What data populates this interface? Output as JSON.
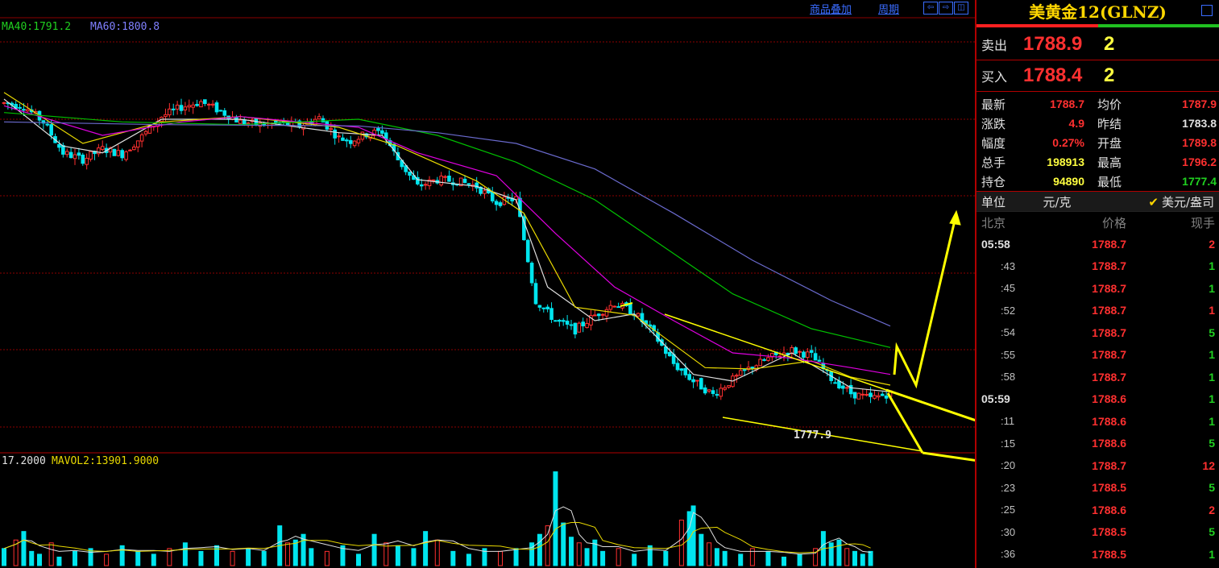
{
  "toolbar": {
    "overlay_label": "商品叠加",
    "period_label": "周期"
  },
  "legend": {
    "ma_line": "MA40:1791.2  MA60:1800.8",
    "ma40": "MA40:1791.2",
    "ma60": "MA60:1800.8",
    "vol_line_a": "17.2000",
    "vol_line_b": "MAVOL2:13901.9000",
    "low_label": "1777.9"
  },
  "colors": {
    "up": "#ff3030",
    "down": "#00e5ee",
    "ma_white": "#e0e0e0",
    "ma_yellow": "#e8d800",
    "ma_magenta": "#e000e0",
    "ma_green": "#00c000",
    "ma_blue": "#6a6acd",
    "annotation": "#ffff00",
    "grid": "#8b0000"
  },
  "chart_data": {
    "type": "candlestick",
    "price_range": [
      1776.0,
      1806.0
    ],
    "price_points": [
      [
        0,
        1801.2
      ],
      [
        5,
        1801.0
      ],
      [
        10,
        1799.8
      ],
      [
        15,
        1797.5
      ],
      [
        20,
        1797.0
      ],
      [
        25,
        1797.8
      ],
      [
        30,
        1797.4
      ],
      [
        35,
        1798.7
      ],
      [
        40,
        1800.2
      ],
      [
        45,
        1800.9
      ],
      [
        50,
        1801.3
      ],
      [
        55,
        1800.6
      ],
      [
        60,
        1799.8
      ],
      [
        65,
        1799.6
      ],
      [
        70,
        1799.7
      ],
      [
        75,
        1799.5
      ],
      [
        80,
        1800.1
      ],
      [
        85,
        1798.6
      ],
      [
        88,
        1798.4
      ],
      [
        92,
        1798.9
      ],
      [
        96,
        1799.1
      ],
      [
        100,
        1797.0
      ],
      [
        105,
        1795.0
      ],
      [
        110,
        1795.5
      ],
      [
        115,
        1795.4
      ],
      [
        120,
        1795.0
      ],
      [
        125,
        1793.8
      ],
      [
        130,
        1794.1
      ],
      [
        135,
        1786.5
      ],
      [
        140,
        1785.0
      ],
      [
        145,
        1784.3
      ],
      [
        150,
        1785.4
      ],
      [
        155,
        1786.3
      ],
      [
        160,
        1785.6
      ],
      [
        165,
        1784.0
      ],
      [
        170,
        1781.8
      ],
      [
        175,
        1780.5
      ],
      [
        180,
        1779.5
      ],
      [
        185,
        1780.6
      ],
      [
        190,
        1781.6
      ],
      [
        195,
        1782.3
      ],
      [
        200,
        1782.8
      ],
      [
        205,
        1782.4
      ],
      [
        210,
        1780.7
      ],
      [
        215,
        1779.6
      ],
      [
        220,
        1779.2
      ],
      [
        225,
        1779.6
      ]
    ],
    "ma_lines": [
      {
        "name": "MA5",
        "color": "#e0e0e0",
        "points": [
          [
            0,
            1801.5
          ],
          [
            15,
            1798.0
          ],
          [
            25,
            1797.5
          ],
          [
            40,
            1800.0
          ],
          [
            60,
            1800.0
          ],
          [
            85,
            1799.0
          ],
          [
            96,
            1798.8
          ],
          [
            105,
            1795.5
          ],
          [
            120,
            1795.0
          ],
          [
            130,
            1794.0
          ],
          [
            138,
            1787.5
          ],
          [
            150,
            1785.0
          ],
          [
            160,
            1785.5
          ],
          [
            175,
            1781.0
          ],
          [
            185,
            1780.5
          ],
          [
            200,
            1782.6
          ],
          [
            215,
            1780.0
          ],
          [
            225,
            1779.7
          ]
        ]
      },
      {
        "name": "MA10",
        "color": "#e8d800",
        "points": [
          [
            0,
            1802.0
          ],
          [
            20,
            1798.2
          ],
          [
            40,
            1799.8
          ],
          [
            60,
            1800.2
          ],
          [
            85,
            1799.4
          ],
          [
            100,
            1798.0
          ],
          [
            120,
            1795.4
          ],
          [
            132,
            1793.0
          ],
          [
            145,
            1786.0
          ],
          [
            160,
            1785.4
          ],
          [
            178,
            1781.5
          ],
          [
            190,
            1781.4
          ],
          [
            205,
            1782.0
          ],
          [
            215,
            1780.8
          ],
          [
            225,
            1780.2
          ]
        ]
      },
      {
        "name": "MA20",
        "color": "#e000e0",
        "points": [
          [
            0,
            1801.0
          ],
          [
            25,
            1798.8
          ],
          [
            45,
            1799.8
          ],
          [
            60,
            1800.2
          ],
          [
            90,
            1799.4
          ],
          [
            105,
            1797.5
          ],
          [
            125,
            1795.8
          ],
          [
            140,
            1791.5
          ],
          [
            155,
            1787.5
          ],
          [
            170,
            1785.0
          ],
          [
            185,
            1782.6
          ],
          [
            200,
            1782.2
          ],
          [
            215,
            1781.5
          ],
          [
            225,
            1781.0
          ]
        ]
      },
      {
        "name": "MA40",
        "color": "#00c000",
        "points": [
          [
            0,
            1800.5
          ],
          [
            30,
            1799.8
          ],
          [
            60,
            1799.6
          ],
          [
            90,
            1800.0
          ],
          [
            110,
            1798.8
          ],
          [
            130,
            1796.8
          ],
          [
            150,
            1794.0
          ],
          [
            170,
            1790.0
          ],
          [
            185,
            1787.0
          ],
          [
            205,
            1784.4
          ],
          [
            225,
            1783.0
          ]
        ]
      },
      {
        "name": "MA60",
        "color": "#6a6acd",
        "points": [
          [
            0,
            1799.8
          ],
          [
            40,
            1799.6
          ],
          [
            90,
            1799.5
          ],
          [
            110,
            1799.0
          ],
          [
            130,
            1798.2
          ],
          [
            150,
            1796.3
          ],
          [
            170,
            1793.0
          ],
          [
            190,
            1789.5
          ],
          [
            210,
            1786.5
          ],
          [
            225,
            1784.6
          ]
        ]
      }
    ],
    "volumes": [
      [
        0,
        6
      ],
      [
        3,
        9
      ],
      [
        5,
        12
      ],
      [
        7,
        5
      ],
      [
        9,
        4
      ],
      [
        12,
        8
      ],
      [
        14,
        3
      ],
      [
        18,
        5
      ],
      [
        22,
        6
      ],
      [
        26,
        4
      ],
      [
        30,
        7
      ],
      [
        34,
        5
      ],
      [
        38,
        4
      ],
      [
        42,
        6
      ],
      [
        46,
        8
      ],
      [
        50,
        5
      ],
      [
        54,
        7
      ],
      [
        58,
        5
      ],
      [
        62,
        6
      ],
      [
        66,
        5
      ],
      [
        70,
        14
      ],
      [
        72,
        8
      ],
      [
        74,
        9
      ],
      [
        76,
        11
      ],
      [
        78,
        6
      ],
      [
        82,
        5
      ],
      [
        86,
        7
      ],
      [
        90,
        4
      ],
      [
        94,
        11
      ],
      [
        97,
        8
      ],
      [
        100,
        7
      ],
      [
        104,
        6
      ],
      [
        107,
        12
      ],
      [
        110,
        9
      ],
      [
        114,
        5
      ],
      [
        118,
        4
      ],
      [
        122,
        6
      ],
      [
        126,
        5
      ],
      [
        130,
        6
      ],
      [
        134,
        8
      ],
      [
        136,
        11
      ],
      [
        138,
        14
      ],
      [
        140,
        33
      ],
      [
        142,
        15
      ],
      [
        144,
        10
      ],
      [
        146,
        8
      ],
      [
        148,
        6
      ],
      [
        150,
        9
      ],
      [
        152,
        5
      ],
      [
        156,
        6
      ],
      [
        160,
        4
      ],
      [
        164,
        7
      ],
      [
        168,
        5
      ],
      [
        172,
        16
      ],
      [
        174,
        19
      ],
      [
        175,
        21
      ],
      [
        177,
        11
      ],
      [
        179,
        8
      ],
      [
        181,
        6
      ],
      [
        183,
        5
      ],
      [
        187,
        4
      ],
      [
        190,
        6
      ],
      [
        194,
        5
      ],
      [
        198,
        3
      ],
      [
        202,
        4
      ],
      [
        206,
        6
      ],
      [
        208,
        12
      ],
      [
        210,
        8
      ],
      [
        212,
        9
      ],
      [
        214,
        6
      ],
      [
        216,
        5
      ],
      [
        218,
        4
      ],
      [
        220,
        5
      ]
    ]
  },
  "panel": {
    "title": "美黄金12(GLNZ)",
    "sell_label": "卖出",
    "sell_price": "1788.9",
    "sell_vol": "2",
    "buy_label": "买入",
    "buy_price": "1788.4",
    "buy_vol": "2",
    "stats": [
      {
        "k": "最新",
        "v": "1788.7",
        "vc": "#ff3030",
        "k2": "均价",
        "v2": "1787.9",
        "v2c": "#ff3030"
      },
      {
        "k": "涨跌",
        "v": "4.9",
        "vc": "#ff3030",
        "k2": "昨结",
        "v2": "1783.8",
        "v2c": "#e0e0e0"
      },
      {
        "k": "幅度",
        "v": "0.27%",
        "vc": "#ff3030",
        "k2": "开盘",
        "v2": "1789.8",
        "v2c": "#ff3030"
      },
      {
        "k": "总手",
        "v": "198913",
        "vc": "#ffff40",
        "k2": "最高",
        "v2": "1796.2",
        "v2c": "#ff3030"
      },
      {
        "k": "持仓",
        "v": "94890",
        "vc": "#ffff40",
        "k2": "最低",
        "v2": "1777.4",
        "v2c": "#20d020"
      }
    ],
    "unit_label": "单位",
    "unit_value": "元/克",
    "unit_checked": "美元/盎司",
    "tick_headers": {
      "time": "北京",
      "price": "价格",
      "vol": "现手"
    },
    "ticks": [
      {
        "t": "05:58",
        "main": true,
        "p": "1788.7",
        "v": "2",
        "vc": "#ff3030"
      },
      {
        "t": ":43",
        "main": false,
        "p": "1788.7",
        "v": "1",
        "vc": "#20d020"
      },
      {
        "t": ":45",
        "main": false,
        "p": "1788.7",
        "v": "1",
        "vc": "#20d020"
      },
      {
        "t": ":52",
        "main": false,
        "p": "1788.7",
        "v": "1",
        "vc": "#ff3030"
      },
      {
        "t": ":54",
        "main": false,
        "p": "1788.7",
        "v": "5",
        "vc": "#20d020"
      },
      {
        "t": ":55",
        "main": false,
        "p": "1788.7",
        "v": "1",
        "vc": "#20d020"
      },
      {
        "t": ":58",
        "main": false,
        "p": "1788.7",
        "v": "1",
        "vc": "#20d020"
      },
      {
        "t": "05:59",
        "main": true,
        "p": "1788.6",
        "v": "1",
        "vc": "#20d020"
      },
      {
        "t": ":11",
        "main": false,
        "p": "1788.6",
        "v": "1",
        "vc": "#20d020"
      },
      {
        "t": ":15",
        "main": false,
        "p": "1788.6",
        "v": "5",
        "vc": "#20d020"
      },
      {
        "t": ":20",
        "main": false,
        "p": "1788.7",
        "v": "12",
        "vc": "#ff3030"
      },
      {
        "t": ":23",
        "main": false,
        "p": "1788.5",
        "v": "5",
        "vc": "#20d020"
      },
      {
        "t": ":25",
        "main": false,
        "p": "1788.6",
        "v": "2",
        "vc": "#ff3030"
      },
      {
        "t": ":30",
        "main": false,
        "p": "1788.5",
        "v": "5",
        "vc": "#20d020"
      },
      {
        "t": ":36",
        "main": false,
        "p": "1788.5",
        "v": "1",
        "vc": "#20d020"
      }
    ]
  }
}
